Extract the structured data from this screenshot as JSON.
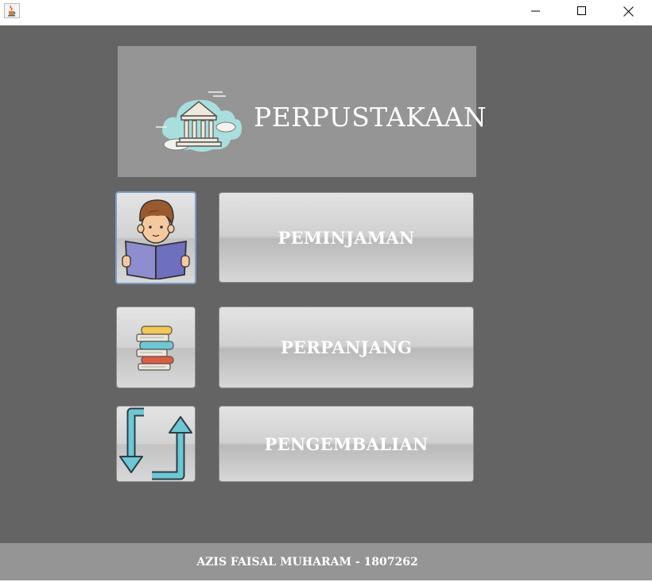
{
  "window": {
    "icon": "java-cup-icon",
    "controls": {
      "minimize": "minimize-icon",
      "maximize": "maximize-icon",
      "close": "close-icon"
    }
  },
  "header": {
    "title": "PERPUSTAKAAN",
    "logo": "library-building-icon"
  },
  "menu": [
    {
      "label": "PEMINJAMAN",
      "icon": "reading-person-icon"
    },
    {
      "label": "PERPANJANG",
      "icon": "book-stack-icon"
    },
    {
      "label": "PENGEMBALIAN",
      "icon": "return-arrows-icon"
    }
  ],
  "footer": {
    "text": "AZIS FAISAL MUHARAM - 1807262"
  },
  "colors": {
    "background": "#646464",
    "panel": "#959595",
    "text": "#ffffff",
    "accent_cyan": "#6cc8d4"
  }
}
